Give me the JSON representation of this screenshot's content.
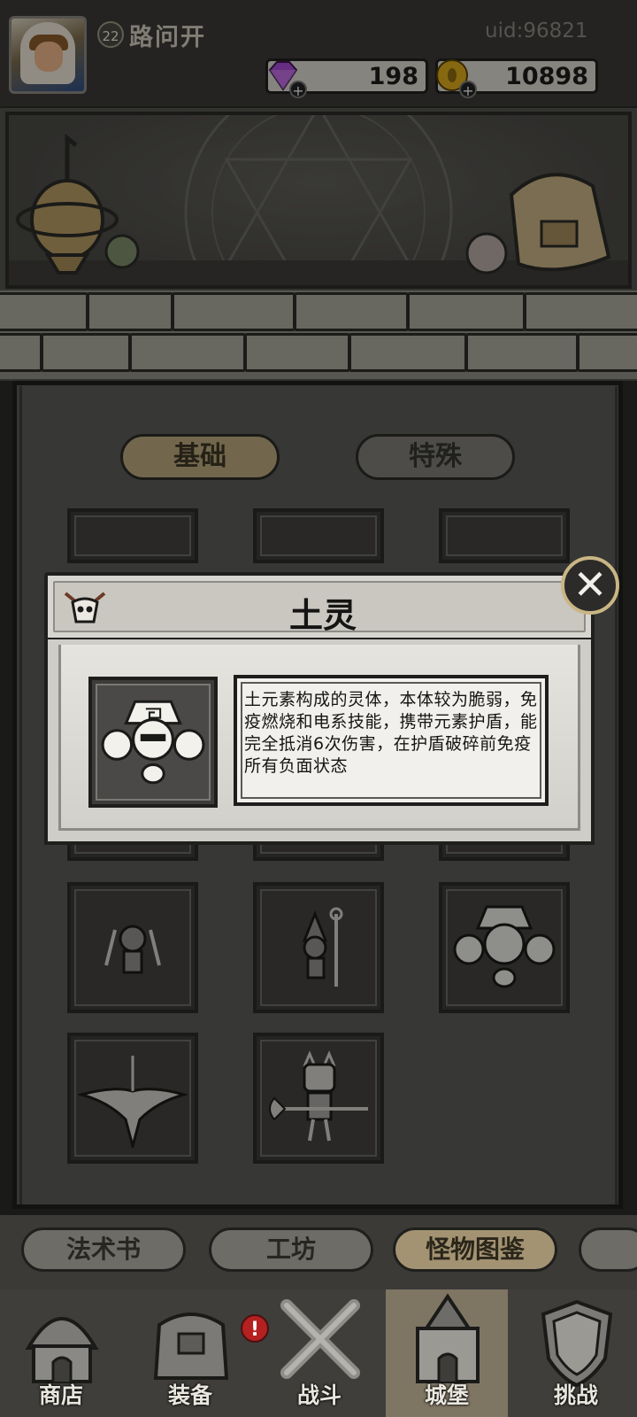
{
  "player": {
    "level": "22",
    "name": "路问开",
    "uid": "uid:96821"
  },
  "currency": {
    "gems": "198",
    "gold": "10898"
  },
  "category_tabs": {
    "basic": "基础",
    "special": "特殊"
  },
  "modal": {
    "title": "土灵",
    "description": "土元素构成的灵体，本体较为脆弱，免疫燃烧和电系技能，携带元素护盾，能完全抵消6次伤害，在护盾破碎前免疫所有负面状态"
  },
  "section_tabs": {
    "spellbook": "法术书",
    "workshop": "工坊",
    "bestiary": "怪物图鉴"
  },
  "nav": {
    "shop": "商店",
    "equipment": "装备",
    "battle": "战斗",
    "castle": "城堡",
    "challenge": "挑战"
  },
  "notification_mark": "!",
  "colors": {
    "accent_gold": "#c9b684",
    "active_tab": "#b8a67c",
    "gem": "#a34bd0",
    "coin": "#d9a91a",
    "alert": "#b52020"
  }
}
